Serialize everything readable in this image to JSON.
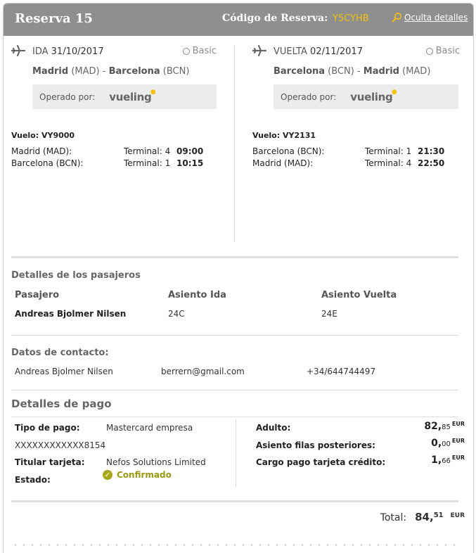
{
  "header": {
    "title": "Reserva 15",
    "code_label": "Código de Reserva:",
    "code_value": "Y5CYHB",
    "hide_details": "Oculta detalles"
  },
  "outbound": {
    "direction": "IDA",
    "date": "31/10/2017",
    "fare": "Basic",
    "origin": "Madrid",
    "origin_code": "(MAD)",
    "separator": "-",
    "destination": "Barcelona",
    "destination_code": "(BCN)",
    "operated_label": "Operado por:",
    "airline": "vueling",
    "flight_number": "Vuelo: VY9000",
    "segments": [
      {
        "city": "Madrid (MAD):",
        "terminal": "Terminal: 4",
        "time": "09:00"
      },
      {
        "city": "Barcelona (BCN):",
        "terminal": "Terminal: 1",
        "time": "10:15"
      }
    ]
  },
  "return": {
    "direction": "VUELTA",
    "date": "02/11/2017",
    "fare": "Basic",
    "origin": "Barcelona",
    "origin_code": "(BCN)",
    "separator": "-",
    "destination": "Madrid",
    "destination_code": "(MAD)",
    "operated_label": "Operado por:",
    "airline": "vueling",
    "flight_number": "Vuelo: VY2131",
    "segments": [
      {
        "city": "Barcelona (BCN):",
        "terminal": "Terminal: 1",
        "time": "21:30"
      },
      {
        "city": "Madrid (MAD):",
        "terminal": "Terminal: 4",
        "time": "22:50"
      }
    ]
  },
  "passengers": {
    "title": "Detalles de los pasajeros",
    "headers": [
      "Pasajero",
      "Asiento Ida",
      "Asiento Vuelta"
    ],
    "rows": [
      {
        "name": "Andreas Bjolmer Nilsen",
        "seat_out": "24C",
        "seat_ret": "24E"
      }
    ]
  },
  "contact": {
    "title": "Datos de contacto:",
    "name": "Andreas Bjolmer Nilsen",
    "email": "berrern@gmail.com",
    "phone": "+34/644744497"
  },
  "payment": {
    "title": "Detalles de pago",
    "type_label": "Tipo de pago:",
    "type_value": "Mastercard empresa",
    "card_number": "XXXXXXXXXXXX8154",
    "holder_label": "Titular tarjeta:",
    "holder_value": "Nefos Solutions Limited",
    "status_label": "Estado:",
    "status_value": "Confirmado",
    "lines": [
      {
        "label": "Adulto:",
        "int": "82,",
        "dec": "85",
        "cur": "EUR"
      },
      {
        "label": "Asiento filas posteriores:",
        "int": "0,",
        "dec": "00",
        "cur": "EUR"
      },
      {
        "label": "Cargo pago tarjeta crédito:",
        "int": "1,",
        "dec": "66",
        "cur": "EUR"
      }
    ],
    "total_label": "Total:",
    "total_int": "84,",
    "total_dec": "51",
    "total_cur": "EUR"
  },
  "colors": {
    "header_bg": "#8f8f8f",
    "accent": "#f4c20d",
    "confirmed": "#9a9a10"
  }
}
